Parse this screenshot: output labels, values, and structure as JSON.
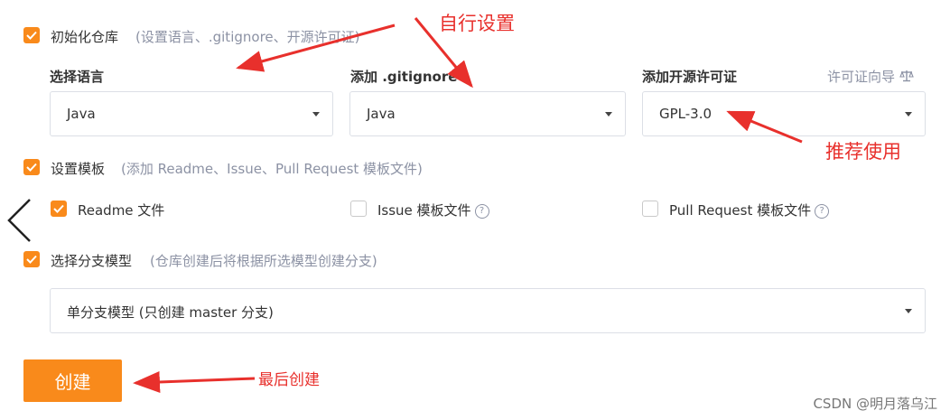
{
  "init_repo": {
    "label": "初始化仓库",
    "hint": "(设置语言、.gitignore、开源许可证)",
    "checked": true
  },
  "language": {
    "title": "选择语言",
    "value": "Java"
  },
  "gitignore": {
    "title": "添加 .gitignore",
    "value": "Java"
  },
  "license": {
    "title": "添加开源许可证",
    "wizard_link": "许可证向导",
    "value": "GPL-3.0"
  },
  "template": {
    "label": "设置模板",
    "hint": "(添加 Readme、Issue、Pull Request 模板文件)",
    "checked": true,
    "options": [
      {
        "label": "Readme 文件",
        "checked": true
      },
      {
        "label": "Issue 模板文件",
        "checked": false
      },
      {
        "label": "Pull Request 模板文件",
        "checked": false
      }
    ]
  },
  "branch_model": {
    "label": "选择分支模型",
    "hint": "(仓库创建后将根据所选模型创建分支)",
    "checked": true,
    "value": "单分支模型 (只创建 master 分支)"
  },
  "create_button": "创建",
  "annotations": {
    "self_setting": "自行设置",
    "recommended": "推荐使用",
    "create_last": "最后创建"
  },
  "watermark": "CSDN @明月落乌江",
  "colors": {
    "accent": "#f98a1b",
    "annotation": "#e8302c"
  }
}
